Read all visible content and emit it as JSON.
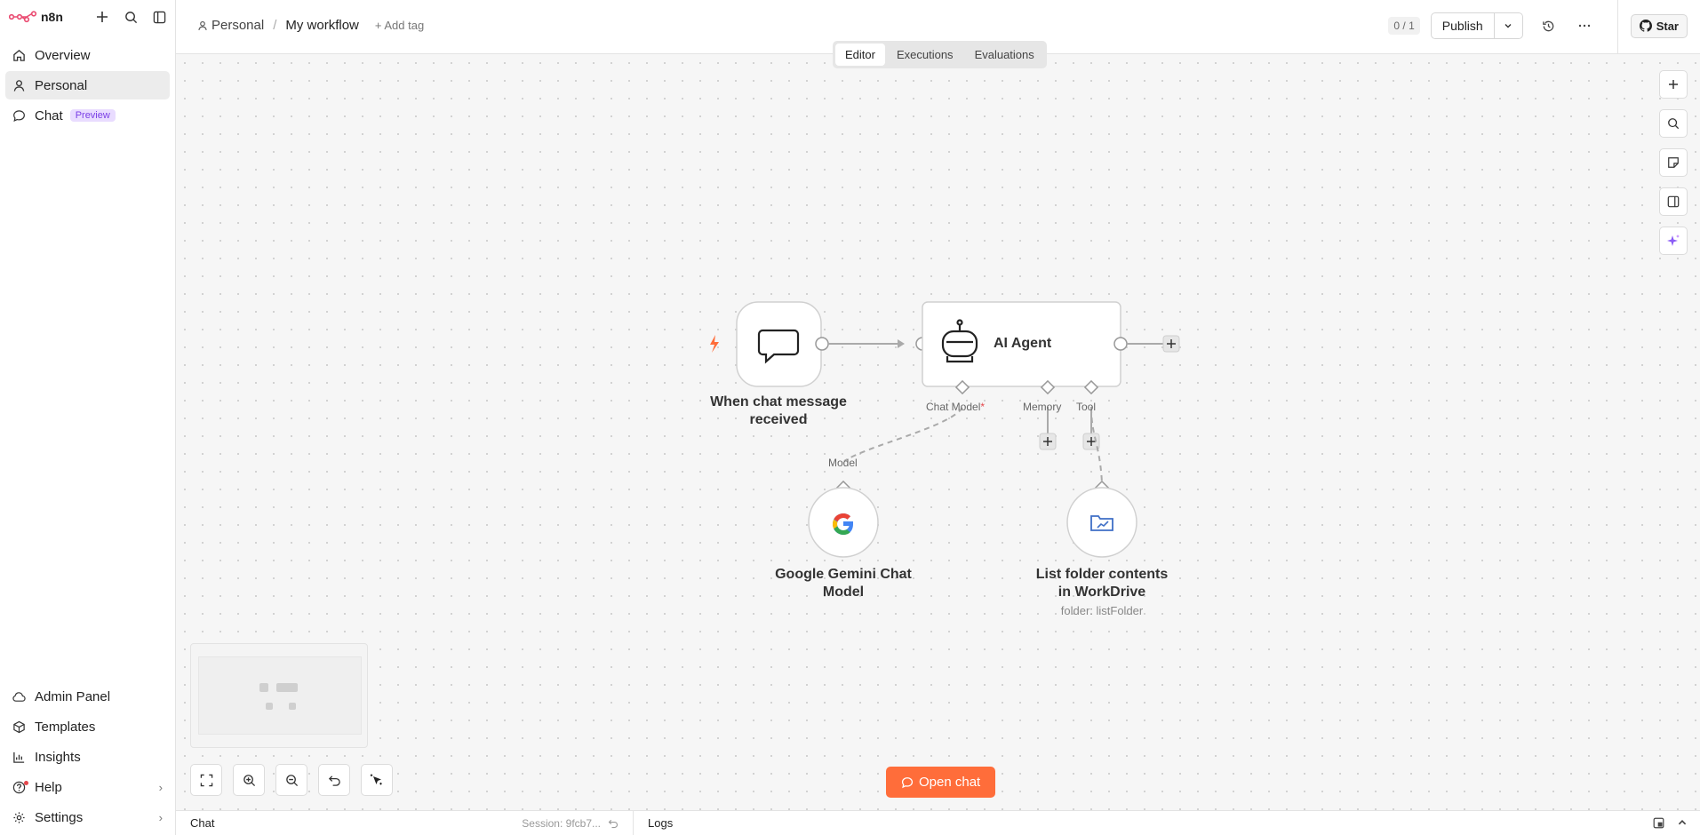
{
  "app": {
    "name": "n8n"
  },
  "sidebar": {
    "items": [
      {
        "label": "Overview",
        "icon": "home-icon"
      },
      {
        "label": "Personal",
        "icon": "user-icon"
      },
      {
        "label": "Chat",
        "icon": "chat-icon",
        "badge": "Preview"
      }
    ],
    "bottom": [
      {
        "label": "Admin Panel",
        "icon": "cloud-icon"
      },
      {
        "label": "Templates",
        "icon": "box-icon"
      },
      {
        "label": "Insights",
        "icon": "chart-icon"
      },
      {
        "label": "Help",
        "icon": "help-icon"
      },
      {
        "label": "Settings",
        "icon": "gear-icon"
      }
    ]
  },
  "header": {
    "breadcrumb_project": "Personal",
    "breadcrumb_sep": "/",
    "workflow_name": "My workflow",
    "add_tag": "+ Add tag",
    "counter": "0 / 1",
    "publish": "Publish",
    "github_star": "Star"
  },
  "tabs": [
    "Editor",
    "Executions",
    "Evaluations"
  ],
  "nodes": {
    "trigger": {
      "label_line1": "When chat message",
      "label_line2": "received"
    },
    "agent": {
      "label": "AI Agent",
      "ports": {
        "chat_model": "Chat Model",
        "required": "*",
        "memory": "Memory",
        "tool": "Tool"
      }
    },
    "gemini": {
      "label_line1": "Google Gemini Chat",
      "label_line2": "Model",
      "port": "Model"
    },
    "workdrive": {
      "label_line1": "List folder contents",
      "label_line2": "in WorkDrive",
      "subtitle": "folder: listFolder"
    }
  },
  "canvas": {
    "open_chat": "Open chat"
  },
  "bottombar": {
    "chat": "Chat",
    "session": "Session: 9fcb7...",
    "logs": "Logs"
  },
  "colors": {
    "accent": "#ff6d3a",
    "preview_badge": "#7a3ee6"
  }
}
